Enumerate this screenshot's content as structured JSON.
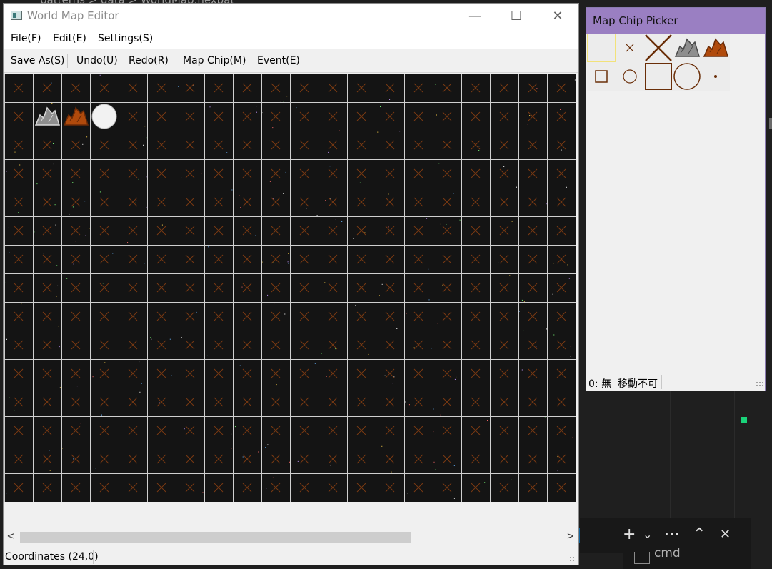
{
  "background": {
    "path_text": "patterns > data > WorldMap.hexbat",
    "terminal_tab_label": "cmd",
    "terminal_buttons": [
      "+",
      "⌄",
      "⋯",
      "⌃",
      "✕"
    ]
  },
  "window": {
    "title": "World Map Editor",
    "controls": {
      "minimize": "—",
      "maximize": "☐",
      "close": "✕"
    },
    "icon": "map-editor-icon"
  },
  "menu": {
    "items": [
      "File(F)",
      "Edit(E)",
      "Settings(S)"
    ]
  },
  "toolbar": {
    "items": [
      "Save As(S)",
      "Undo(U)",
      "Redo(R)",
      "Map Chip(M)",
      "Event(E)"
    ]
  },
  "map": {
    "columns": 20,
    "rows": 15,
    "default_tile": "cross",
    "placed_tiles": [
      {
        "col": 1,
        "row": 1,
        "chip": "gray-rock"
      },
      {
        "col": 2,
        "row": 1,
        "chip": "brown-rock"
      },
      {
        "col": 3,
        "row": 1,
        "chip": "white-circle"
      }
    ],
    "colors": {
      "background": "#141414",
      "grid": "#cfcfcf",
      "cross": "#7a3a12"
    }
  },
  "scrollbar": {
    "left_arrow": "<",
    "right_arrow": ">",
    "position": 0.0
  },
  "status": {
    "coordinates": "Coordinates (24,0)"
  },
  "picker": {
    "title": "Map Chip Picker",
    "status": "0: 無  移動不可",
    "chips": [
      "empty",
      "small-cross",
      "big-cross",
      "gray-rock",
      "brown-rock",
      "small-square",
      "small-circle",
      "big-square",
      "big-circle",
      "dot"
    ],
    "selected_index": 0,
    "colors": {
      "selection": "#f2e27a",
      "chip_brown": "#6a2e08",
      "title_bar": "#9a7fc2"
    }
  }
}
